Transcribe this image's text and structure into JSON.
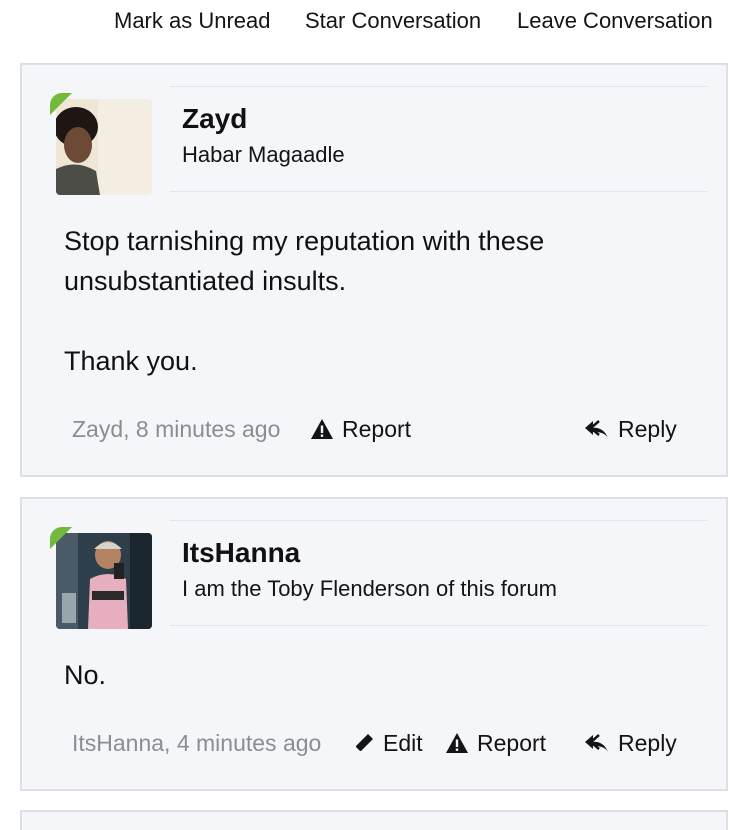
{
  "top_actions": {
    "mark_unread": "Mark as Unread",
    "star": "Star Conversation",
    "leave": "Leave Conversation"
  },
  "messages": [
    {
      "username": "Zayd",
      "user_title": "Habar Magaadle",
      "body": [
        "Stop tarnishing my reputation with these",
        "unsubstantiated insults.",
        "Thank you."
      ],
      "meta": "Zayd, 8 minutes ago",
      "actions": {
        "report": "Report",
        "reply": "Reply"
      }
    },
    {
      "username": "ItsHanna",
      "user_title": "I am the Toby Flenderson of this forum",
      "body": [
        "No."
      ],
      "meta": "ItsHanna, 4 minutes ago",
      "actions": {
        "edit": "Edit",
        "report": "Report",
        "reply": "Reply"
      }
    }
  ],
  "colors": {
    "card_bg": "#f5f6fa",
    "card_border": "#dcdfe5",
    "online_indicator": "#73b93b",
    "meta_text": "#8a8d91"
  },
  "icons": {
    "report": "warning-triangle-icon",
    "reply": "reply-arrow-icon",
    "edit": "pencil-icon"
  }
}
